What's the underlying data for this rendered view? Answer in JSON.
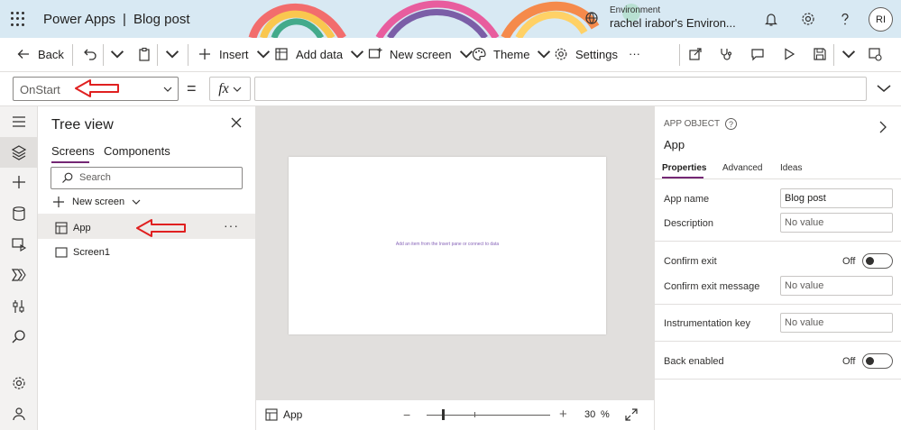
{
  "header": {
    "app_name": "Power Apps",
    "separator": "|",
    "doc_name": "Blog post",
    "env_label": "Environment",
    "env_name": "rachel irabor's Environ...",
    "avatar_initials": "RI"
  },
  "toolbar": {
    "back": "Back",
    "insert": "Insert",
    "add_data": "Add data",
    "new_screen": "New screen",
    "theme": "Theme",
    "settings": "Settings",
    "more": "···"
  },
  "formula": {
    "property": "OnStart",
    "equals": "=",
    "fx": "fx",
    "value": ""
  },
  "tree": {
    "title": "Tree view",
    "tabs": [
      "Screens",
      "Components"
    ],
    "search_placeholder": "Search",
    "new_screen": "New screen",
    "items": [
      "App",
      "Screen1"
    ],
    "more": "···"
  },
  "canvas": {
    "hint": "Add an item from the Insert pane or connect to data"
  },
  "status": {
    "selected": "App",
    "zoom_minus": "−",
    "zoom_plus": "+",
    "zoom_value": "30",
    "zoom_unit": "%",
    "zoom_level": 30
  },
  "props": {
    "object_type": "APP OBJECT",
    "object_name": "App",
    "tabs": [
      "Properties",
      "Advanced",
      "Ideas"
    ],
    "app_name_label": "App name",
    "app_name_value": "Blog post",
    "description_label": "Description",
    "description_value": "No value",
    "confirm_exit_label": "Confirm exit",
    "confirm_exit_state": "Off",
    "confirm_exit_msg_label": "Confirm exit message",
    "confirm_exit_msg_value": "No value",
    "instrumentation_label": "Instrumentation key",
    "instrumentation_value": "No value",
    "back_enabled_label": "Back enabled",
    "back_enabled_state": "Off"
  },
  "colors": {
    "accent": "#742774",
    "annotation_arrow": "#e02020",
    "canvas_bg": "#e1dfdd"
  }
}
